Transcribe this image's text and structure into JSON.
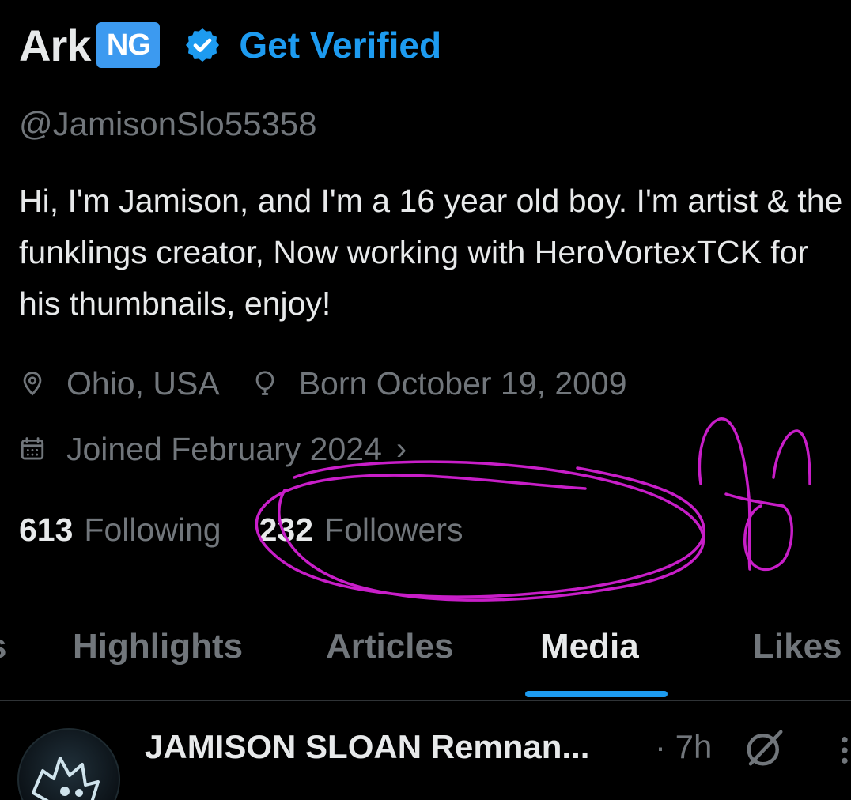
{
  "profile": {
    "display_name": "Ark",
    "flag_badge": "NG",
    "get_verified_label": "Get Verified",
    "handle": "@JamisonSlo55358",
    "bio": "Hi, I'm Jamison, and I'm a 16 year old boy. I'm artist & the funklings creator, Now working with HeroVortexTCK for his thumbnails, enjoy!",
    "location": "Ohio, USA",
    "birthday": "Born October 19, 2009",
    "joined": "Joined February 2024",
    "following_count": "613",
    "following_label": "Following",
    "followers_count": "232",
    "followers_label": "Followers"
  },
  "tabs": {
    "edge": "s",
    "items": [
      {
        "label": "Highlights",
        "active": false
      },
      {
        "label": "Articles",
        "active": false
      },
      {
        "label": "Media",
        "active": true
      },
      {
        "label": "Likes",
        "active": false
      }
    ]
  },
  "post": {
    "author": "JAMISON SLOAN Remnan...",
    "time": "· 7h"
  },
  "colors": {
    "accent": "#1d9bf0",
    "muted_text": "#71767b",
    "primary_text": "#e7e9ea",
    "annotation": "#c81ec8",
    "background": "#000000"
  },
  "icons": {
    "verified": "verified-badge-icon",
    "location": "location-pin-icon",
    "birthday": "balloon-icon",
    "calendar": "calendar-icon",
    "grok": "grok-icon",
    "more": "more-vertical-icon"
  }
}
